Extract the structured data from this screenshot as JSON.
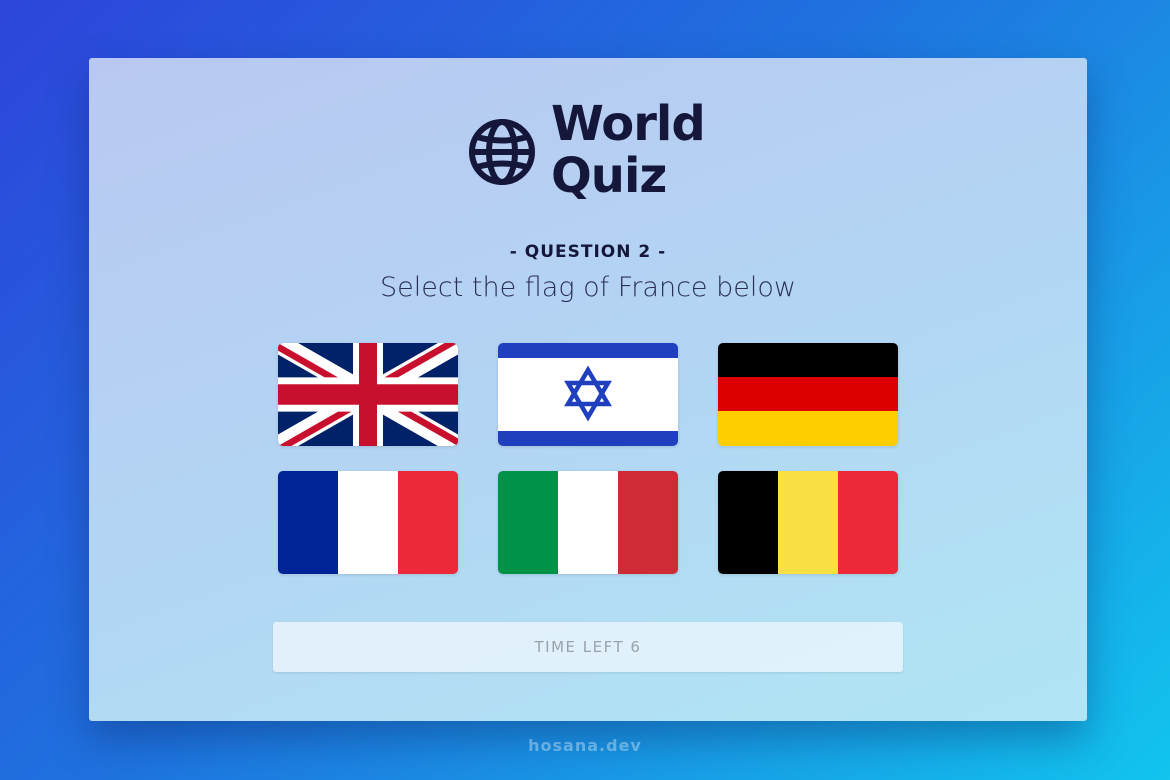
{
  "logo": {
    "line1": "World",
    "line2": "Quiz",
    "icon": "globe-icon"
  },
  "question": {
    "number_label": "- QUESTION 2 -",
    "prompt": "Select the flag of France below"
  },
  "flags": [
    {
      "icon": "united-kingdom-flag"
    },
    {
      "icon": "israel-flag"
    },
    {
      "icon": "germany-flag"
    },
    {
      "icon": "france-flag"
    },
    {
      "icon": "italy-flag"
    },
    {
      "icon": "belgium-flag"
    }
  ],
  "timer": {
    "label": "TIME LEFT 6"
  },
  "watermark": "hosana.dev",
  "colors": {
    "background_start": "#2d45db",
    "background_end": "#12c4ee",
    "text_dark": "#15173a"
  }
}
